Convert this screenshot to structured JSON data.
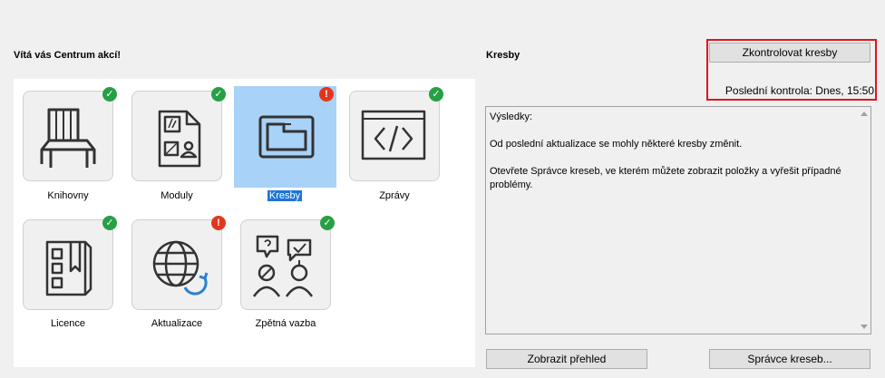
{
  "welcome": {
    "title": "Vítá vás Centrum akcí!"
  },
  "tiles": [
    {
      "label": "Knihovny",
      "status": "ok",
      "icon": "chair-icon"
    },
    {
      "label": "Moduly",
      "status": "ok",
      "icon": "module-document-icon"
    },
    {
      "label": "Kresby",
      "status": "warning",
      "icon": "drawing-folder-icon",
      "selected": true
    },
    {
      "label": "Zprávy",
      "status": "ok",
      "icon": "code-report-icon"
    },
    {
      "label": "Licence",
      "status": "ok",
      "icon": "license-book-icon"
    },
    {
      "label": "Aktualizace",
      "status": "warning",
      "icon": "globe-update-icon"
    },
    {
      "label": "Zpětná vazba",
      "status": "ok",
      "icon": "feedback-people-icon"
    }
  ],
  "badges": {
    "ok": "✓",
    "warning": "!"
  },
  "colors": {
    "ok": "#26a044",
    "warning": "#e2361d",
    "selection": "#a8d2f7",
    "highlight": "#e0141e"
  },
  "details": {
    "title": "Kresby",
    "check_button": "Zkontrolovat kresby",
    "last_check": "Poslední kontrola: Dnes, 15:50",
    "results": {
      "heading": "Výsledky:",
      "line1": "Od poslední aktualizace se mohly některé kresby změnit.",
      "line2": "Otevřete Správce kreseb, ve kterém můžete zobrazit položky a vyřešit případné problémy."
    },
    "overview_button": "Zobrazit přehled",
    "manager_button": "Správce kreseb..."
  }
}
